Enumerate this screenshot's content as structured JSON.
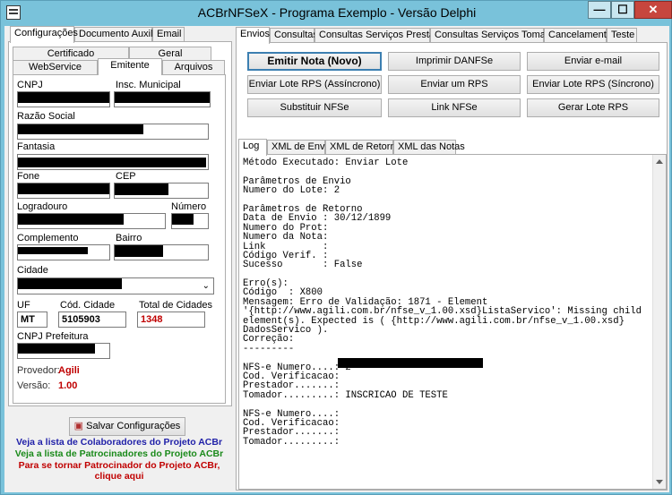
{
  "window": {
    "title": "ACBrNFSeX - Programa Exemplo - Versão Delphi",
    "min_label": "—",
    "max_label": "☐",
    "close_label": "✕"
  },
  "left_tabs": [
    "Configurações",
    "Documento Auxiliar",
    "Email"
  ],
  "sub_tabs_row1": [
    "Certificado",
    "Geral"
  ],
  "sub_tabs_row2": [
    "WebService",
    "Emitente",
    "Arquivos"
  ],
  "emitente": {
    "cnpj_label": "CNPJ",
    "insc_label": "Insc. Municipal",
    "razao_label": "Razão Social",
    "fantasia_label": "Fantasia",
    "fone_label": "Fone",
    "cep_label": "CEP",
    "logradouro_label": "Logradouro",
    "numero_label": "Número",
    "complemento_label": "Complemento",
    "bairro_label": "Bairro",
    "cidade_label": "Cidade",
    "uf_label": "UF",
    "uf_value": "MT",
    "cod_cidade_label": "Cód. Cidade",
    "cod_cidade_value": "5105903",
    "total_cidades_label": "Total de Cidades",
    "total_cidades_value": "1348",
    "cnpj_prefeitura_label": "CNPJ Prefeitura",
    "provedor_label": "Provedor:",
    "provedor_value": "Agili",
    "versao_label": "Versão:",
    "versao_value": "1.00"
  },
  "salvar_label": "Salvar Configurações",
  "links": {
    "colaboradores": "Veja a lista de Colaboradores do Projeto ACBr",
    "patrocinadores": "Veja a lista de Patrocinadores do Projeto ACBr",
    "patrocinador_line1": "Para se tornar Patrocinador do Projeto ACBr,",
    "patrocinador_line2": "clique aqui",
    "colors": {
      "colaboradores": "#1f1fa8",
      "patrocinadores": "#1a8a1a",
      "patrocinador": "#c00000"
    }
  },
  "main_tabs": [
    "Envios",
    "Consultas",
    "Consultas Serviços Prestados",
    "Consultas Serviços Tomados",
    "Cancelamento",
    "Teste"
  ],
  "buttons": {
    "emitir": "Emitir Nota (Novo)",
    "imprimir": "Imprimir DANFSe",
    "enviar_email": "Enviar e-mail",
    "lote_assinc": "Enviar Lote RPS (Assíncrono)",
    "enviar_rps": "Enviar um RPS",
    "lote_sinc": "Enviar Lote RPS (Síncrono)",
    "substituir": "Substituir NFSe",
    "link": "Link NFSe",
    "gerar_lote": "Gerar Lote RPS"
  },
  "log_tabs": [
    "Log",
    "XML de Envio",
    "XML de Retorno",
    "XML das Notas"
  ],
  "log_lines": [
    "Método Executado: Enviar Lote",
    "",
    "Parâmetros de Envio",
    "Numero do Lote: 2",
    "",
    "Parâmetros de Retorno",
    "Data de Envio : 30/12/1899",
    "Numero do Prot:",
    "Numero da Nota:",
    "Link          :",
    "Código Verif. :",
    "Sucesso       : False",
    "",
    "Erro(s):",
    "Código  : X800",
    "Mensagem: Erro de Validação: 1871 - Element",
    "'{http://www.agili.com.br/nfse_v_1.00.xsd}ListaServico': Missing child",
    "element(s). Expected is ( {http://www.agili.com.br/nfse_v_1.00.xsd}",
    "DadosServico ).",
    "Correção:",
    "---------",
    "",
    "NFS-e Numero....: 2",
    "Cod. Verificacao:",
    "Prestador.......:",
    "Tomador.........: INSCRICAO DE TESTE",
    "",
    "NFS-e Numero....:",
    "Cod. Verificacao:",
    "Prestador.......:",
    "Tomador.........:"
  ]
}
